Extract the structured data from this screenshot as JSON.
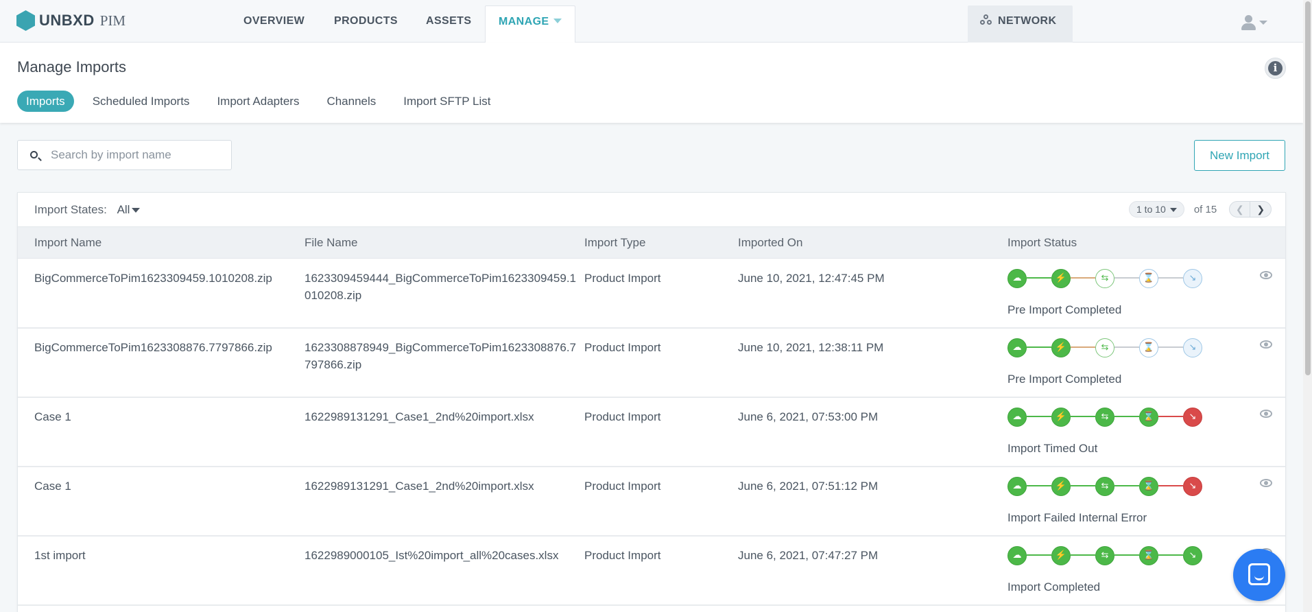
{
  "nav": {
    "brand": "UNBXD",
    "product": "PIM",
    "links": [
      "OVERVIEW",
      "PRODUCTS",
      "ASSETS",
      "MANAGE"
    ],
    "active": "MANAGE",
    "network": "NETWORK"
  },
  "header": {
    "title": "Manage Imports",
    "tabs": [
      "Imports",
      "Scheduled Imports",
      "Import Adapters",
      "Channels",
      "Import SFTP List"
    ],
    "active_tab": "Imports"
  },
  "toolbar": {
    "search_placeholder": "Search by import name",
    "new_import_label": "New Import"
  },
  "filters": {
    "states_label": "Import States:",
    "states_value": "All",
    "range": "1 to 10",
    "of": "of 15"
  },
  "table": {
    "columns": [
      "Import Name",
      "File Name",
      "Import Type",
      "Imported On",
      "Import Status"
    ],
    "rows": [
      {
        "name": "BigCommerceToPim1623309459.1010208.zip",
        "file": "1623309459444_BigCommerceToPim1623309459.1010208.zip",
        "type": "Product Import",
        "date": "June 10, 2021, 12:47:45 PM",
        "status": "Pre Import Completed",
        "steps": [
          "done",
          "done",
          "pend-g",
          "pend-b",
          "pend-b2"
        ]
      },
      {
        "name": "BigCommerceToPim1623308876.7797866.zip",
        "file": "1623308878949_BigCommerceToPim1623308876.7797866.zip",
        "type": "Product Import",
        "date": "June 10, 2021, 12:38:11 PM",
        "status": "Pre Import Completed",
        "steps": [
          "done",
          "done",
          "pend-g",
          "pend-b",
          "pend-b2"
        ]
      },
      {
        "name": "Case 1",
        "file": "1622989131291_Case1_2nd%20import.xlsx",
        "type": "Product Import",
        "date": "June 6, 2021, 07:53:00 PM",
        "status": "Import Timed Out",
        "steps": [
          "done",
          "done",
          "done",
          "done",
          "fail"
        ]
      },
      {
        "name": "Case 1",
        "file": "1622989131291_Case1_2nd%20import.xlsx",
        "type": "Product Import",
        "date": "June 6, 2021, 07:51:12 PM",
        "status": "Import Failed Internal Error",
        "steps": [
          "done",
          "done",
          "done",
          "done",
          "fail"
        ]
      },
      {
        "name": "1st import",
        "file": "1622989000105_Ist%20import_all%20cases.xlsx",
        "type": "Product Import",
        "date": "June 6, 2021, 07:47:27 PM",
        "status": "Import Completed",
        "steps": [
          "done",
          "done",
          "done",
          "done",
          "done"
        ]
      }
    ]
  },
  "step_icons": [
    "upload-icon",
    "bolt-icon",
    "transfer-icon",
    "hourglass-icon",
    "import-icon"
  ],
  "colors": {
    "accent": "#3aa9b5",
    "success": "#4cb848",
    "error": "#d94a4a",
    "pending": "#9ec7e6"
  }
}
